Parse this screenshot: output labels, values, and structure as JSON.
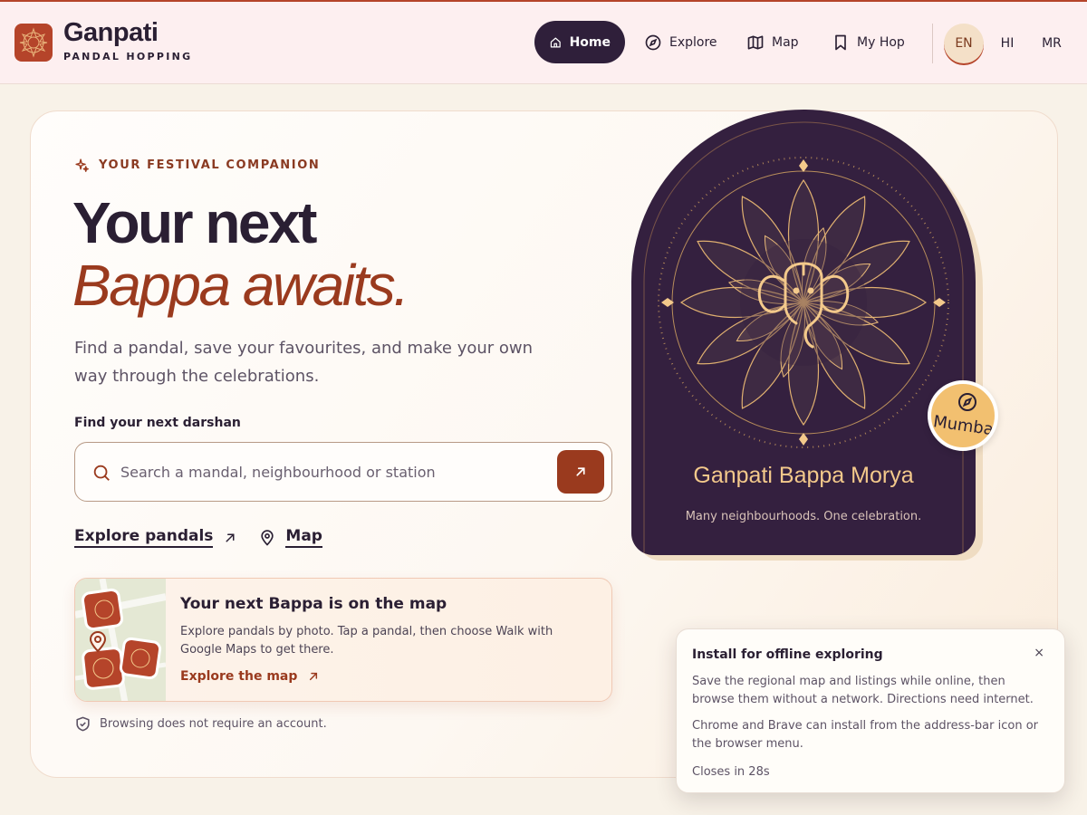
{
  "brand": {
    "title": "Ganpati",
    "subtitle": "PANDAL HOPPING"
  },
  "nav": {
    "items": [
      {
        "label": "Home",
        "icon": "home-icon",
        "active": true
      },
      {
        "label": "Explore",
        "icon": "compass-icon"
      },
      {
        "label": "Map",
        "icon": "map-icon"
      },
      {
        "label": "My Hop",
        "icon": "bookmark-icon"
      }
    ],
    "languages": [
      "EN",
      "HI",
      "MR"
    ],
    "active_language": "EN"
  },
  "hero": {
    "eyebrow": "YOUR FESTIVAL COMPANION",
    "headline_line1": "Your next",
    "headline_line2": "Bappa awaits.",
    "lead": "Find a pandal, save your favourites, and make your own way through the celebrations.",
    "search_label": "Find your next darshan",
    "search_placeholder": "Search a mandal, neighbourhood or station",
    "links": {
      "explore": "Explore pandals",
      "map": "Map"
    },
    "map_card": {
      "title": "Your next Bappa is on the map",
      "body": "Explore pandals by photo. Tap a pandal, then choose Walk with Google Maps to get there.",
      "cta": "Explore the map"
    },
    "note": "Browsing does not require an account."
  },
  "illustration": {
    "title": "Ganpati Bappa Morya",
    "subtitle": "Many neighbourhoods. One celebration.",
    "city_badge": "Mumbai"
  },
  "install_toast": {
    "title": "Install for offline exploring",
    "close": "×",
    "para1": "Save the regional map and listings while online, then browse them without a network. Directions need internet.",
    "para2": "Chrome and Brave can install from the address-bar icon or the browser menu.",
    "countdown": "Closes in 28s"
  },
  "colors": {
    "accent": "#9a3a1e",
    "nav_active_bg": "#2f1f3a",
    "arch_bg": "#34203f",
    "gold": "#f3c98b",
    "header_bg": "#fdeff0"
  }
}
